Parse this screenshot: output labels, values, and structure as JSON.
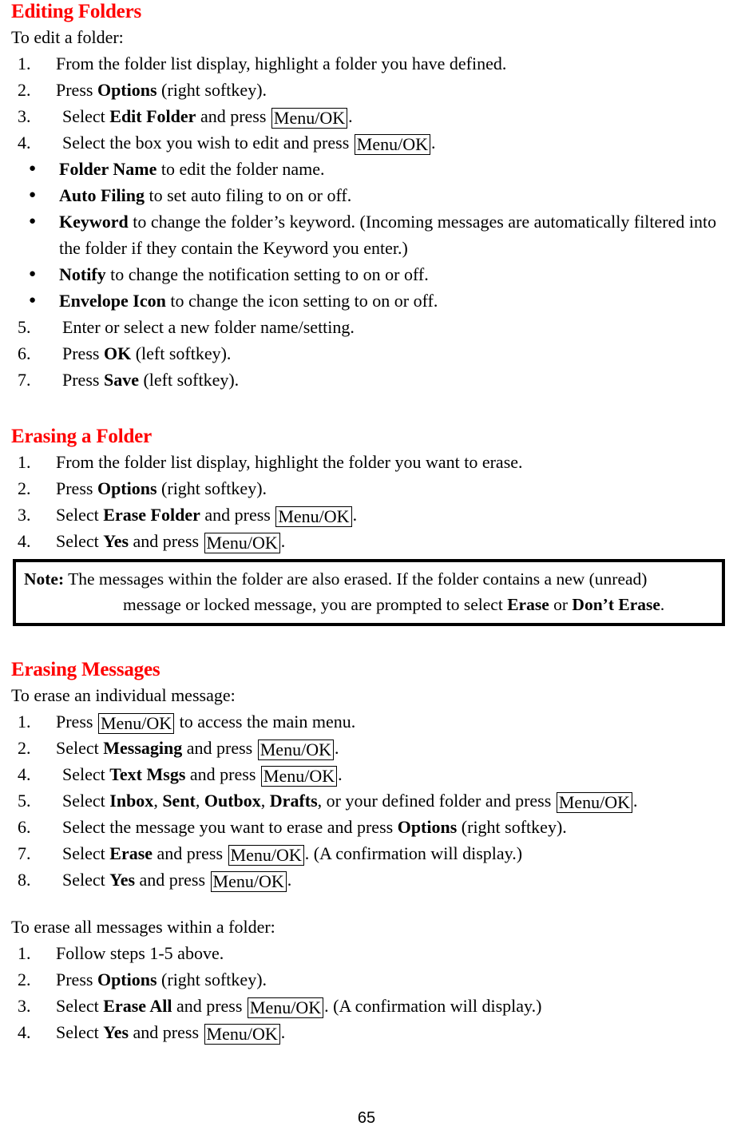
{
  "page": {
    "number": "65",
    "heading_color": "#ff0000",
    "body_color": "#000000"
  },
  "sections": {
    "editing_folders": {
      "heading": "Editing Folders",
      "intro": "To edit a folder:",
      "steps": [
        {
          "marker": "1.",
          "pre": "From the folder list display, highlight a folder you have defined."
        },
        {
          "marker": "2.",
          "pre": "Press ",
          "bold": "Options",
          "post": " (right softkey)."
        },
        {
          "marker": "3.",
          "pre": "Select ",
          "bold": "Edit Folder",
          "mid": " and press ",
          "key": "Menu/OK",
          "post": "."
        },
        {
          "marker": "4.",
          "pre": "Select the box you wish to edit and press ",
          "key": "Menu/OK",
          "post": "."
        }
      ],
      "bullets": [
        {
          "marker": "●",
          "bold": "Folder Name",
          "post": " to edit the folder name."
        },
        {
          "marker": "●",
          "bold": "Auto Filing",
          "post": " to set auto filing to on or off."
        },
        {
          "marker": "●",
          "bold": "Keyword",
          "post": " to change the folder’s keyword. (Incoming messages are automatically filtered into the folder if they contain the Keyword you enter.)"
        },
        {
          "marker": "●",
          "bold": "Notify",
          "post": " to change the notification setting to on or off."
        },
        {
          "marker": "●",
          "bold": "Envelope Icon",
          "post": " to change the icon setting to on or off."
        }
      ],
      "steps_cont": [
        {
          "marker": "5.",
          "pre": "Enter or select a new folder name/setting."
        },
        {
          "marker": "6.",
          "pre": "Press ",
          "bold": "OK",
          "post": " (left softkey)."
        },
        {
          "marker": "7.",
          "pre": "Press ",
          "bold": "Save",
          "post": " (left softkey)."
        }
      ]
    },
    "erasing_a_folder": {
      "heading": "Erasing a Folder",
      "steps": [
        {
          "marker": "1.",
          "pre": "From the folder list display, highlight the folder you want to erase."
        },
        {
          "marker": "2.",
          "pre": "Press ",
          "bold": "Options",
          "post": " (right softkey)."
        },
        {
          "marker": "3.",
          "pre": "Select ",
          "bold": "Erase Folder",
          "mid": " and press ",
          "key": "Menu/OK",
          "post": "."
        },
        {
          "marker": "4.",
          "pre": "Select ",
          "bold": "Yes",
          "mid": " and press ",
          "key": "Menu/OK",
          "post": "."
        }
      ],
      "note": {
        "label": "Note:",
        "line1": " The messages within the folder are also erased. If the folder contains a new (unread)",
        "line2_pre": "message or locked message, you are prompted to select ",
        "line2_bold1": "Erase",
        "line2_mid": " or ",
        "line2_bold2": "Don’t Erase",
        "line2_post": "."
      }
    },
    "erasing_messages": {
      "heading": "Erasing Messages",
      "intro_individual": "To erase an individual message:",
      "steps_individual": [
        {
          "marker": "1.",
          "pre": "Press ",
          "key": "Menu/OK",
          "post": " to access the main menu."
        },
        {
          "marker": "2.",
          "pre": "Select ",
          "bold": "Messaging",
          "mid": " and press ",
          "key": "Menu/OK",
          "post": "."
        },
        {
          "marker": "4.",
          "pre": "Select ",
          "bold": "Text Msgs",
          "mid": " and press ",
          "key": "Menu/OK",
          "post": "."
        },
        {
          "marker": "5.",
          "pre": "Select ",
          "bold_list": [
            "Inbox",
            "Sent",
            "Outbox",
            "Drafts"
          ],
          "mid": ", or your defined folder and press ",
          "key": "Menu/OK",
          "post": "."
        },
        {
          "marker": "6.",
          "pre": "Select the message you want to erase and press ",
          "bold": "Options",
          "post": " (right softkey)."
        },
        {
          "marker": "7.",
          "pre": "Select ",
          "bold": "Erase",
          "mid": " and press ",
          "key": "Menu/OK",
          "post": ". (A confirmation will display.)"
        },
        {
          "marker": "8.",
          "pre": "Select ",
          "bold": "Yes",
          "mid": " and press ",
          "key": "Menu/OK",
          "post": "."
        }
      ],
      "intro_all": "To erase all messages within a folder:",
      "steps_all": [
        {
          "marker": "1.",
          "pre": "Follow steps 1-5 above."
        },
        {
          "marker": "2.",
          "pre": "Press ",
          "bold": "Options",
          "post": " (right softkey)."
        },
        {
          "marker": "3.",
          "pre": "Select ",
          "bold": "Erase All",
          "mid": " and press ",
          "key": "Menu/OK",
          "post": ". (A confirmation will display.)"
        },
        {
          "marker": "4.",
          "pre": "Select ",
          "bold": "Yes",
          "mid": " and press ",
          "key": "Menu/OK",
          "post": "."
        }
      ]
    }
  }
}
